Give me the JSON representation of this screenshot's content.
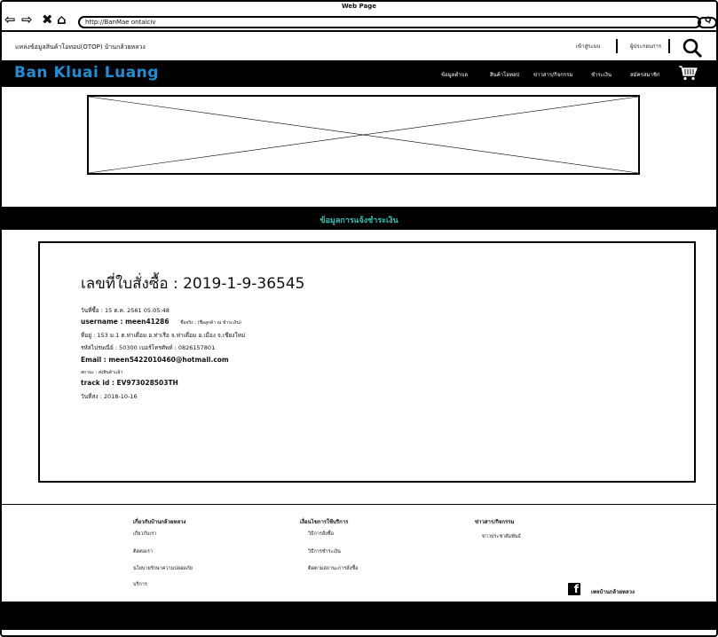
{
  "browser": {
    "window_title": "Web Page",
    "url": "http://BanMae ontaiciv"
  },
  "top": {
    "title": "แหล่งข้อมูลสินค้าโอทอป(OTOP) บ้านกล้วยหลวง",
    "login": "เข้าสู่ระบบ",
    "contact": "ผู้ประกอบการ"
  },
  "navbar": {
    "brand": "Ban Kluai Luang",
    "items": [
      "ข้อมูลตำบล",
      "สินค้าโอทอป",
      "ข่าวสาร/กิจกรรม",
      "ชำระเงิน",
      "สมัครสมาชิก"
    ]
  },
  "section": {
    "title": "ข้อมูลการแจ้งชำระเงิน"
  },
  "order": {
    "order_no": "เลขที่ใบสั่งซื้อ : 2019-1-9-36545",
    "date": "วันที่ซื้อ : 15 ต.ค. 2561 05:05:48",
    "username": "username : meen41286",
    "name": "ชื่อจริง : (ชื่อลูกค้า ณ ชำระเงิน)",
    "address": "ที่อยู่ : 153 ม.1 ต.ท่าเดื่อม อ.ท่าเรือ จ.ท่าเดื่อม อ.เมือง จ.เชียงใหม่",
    "postal_phone": "รหัสไปรษณีย์ : 50300   เบอร์โทรศัพท์ : 0826157801",
    "email": "Email : meen5422010460@hotmail.com",
    "status": "สถานะ : ส่งสินค้าแล้ว",
    "track": "track id : EV973028503TH",
    "ship_date": "วันที่ส่ง : 2018-10-16"
  },
  "footer": {
    "col1_head": "เกี่ยวกับบ้านกล้วยหลวง",
    "col1_links": [
      "เกี่ยวกับเรา",
      "ติดต่อเรา",
      "นโยบายรักษาความปลอดภัย",
      "บริการ"
    ],
    "col2_head": "เงื่อนไขการใช้บริการ",
    "col2_links": [
      "วิธีการสั่งซื้อ",
      "วิธีการชำระเงิน",
      "ติดตามสถานะการสั่งซื้อ"
    ],
    "col3_head": "ข่าวสาร/กิจกรรม",
    "col3_links": [
      "ข่าวประชาสัมพันธ์"
    ],
    "facebook_label": "เพจบ้านกล้วยหลวง"
  }
}
